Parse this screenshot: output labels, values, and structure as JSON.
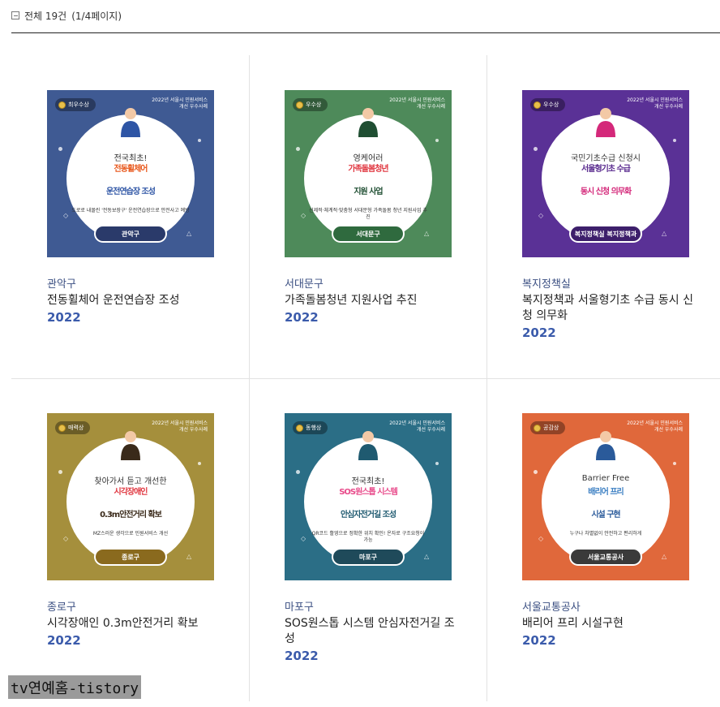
{
  "summary": {
    "total": "전체 19건",
    "page": "(1/4페이지)"
  },
  "cards": [
    {
      "dept": "관악구",
      "title": "전동휠체어 운전연습장 조성",
      "year": "2022",
      "bg": "#3f5a93",
      "accent": "#e8571b",
      "accent2": "#2e55a5",
      "pill_bg": "#2a3a6a",
      "award": "최우수상",
      "corner": "2022년 서울시 민원서비스 개선 우수사례",
      "pre": "전국최초!",
      "big1": "전동휠체어",
      "big2": "운전연습장 조성",
      "sub": "도로로 내몰린 '전동보장구' 운전연습장으로 안전사고 예방",
      "pill": "관악구"
    },
    {
      "dept": "서대문구",
      "title": "가족돌봄청년 지원사업 추진",
      "year": "2022",
      "bg": "#4e8a5a",
      "accent": "#e0363f",
      "accent2": "#1f4e32",
      "pill_bg": "#2f6a3e",
      "award": "우수상",
      "corner": "2022년 서울시 민원서비스 개선 우수사례",
      "pre": "영케어러",
      "big1": "가족돌봄청년",
      "big2": "지원 사업",
      "sub": "선제적·체계적·맞춤형 서대문형 가족돌봄 청년 지원사업 추진",
      "pill": "서대문구"
    },
    {
      "dept": "복지정책실",
      "title": "복지정책과 서울형기초 수급 동시 신청 의무화",
      "year": "2022",
      "bg": "#5a3196",
      "accent": "#5a2b8f",
      "accent2": "#d4287a",
      "pill_bg": "#3d1f6b",
      "award": "우수상",
      "corner": "2022년 서울시 민원서비스 개선 우수사례",
      "pre": "국민기초수급 신청시",
      "big1": "서울형기초 수급",
      "big2": "동시 신청 의무화",
      "sub": "",
      "pill": "복지정책실 복지정책과"
    },
    {
      "dept": "종로구",
      "title": "시각장애인 0.3m안전거리 확보",
      "year": "2022",
      "bg": "#a58f3c",
      "accent": "#e0363f",
      "accent2": "#3a2a1a",
      "pill_bg": "#8a6a1e",
      "award": "매력상",
      "corner": "2022년 서울시 민원서비스 개선 우수사례",
      "pre": "찾아가서 듣고 개선한",
      "big1": "시각장애인",
      "big2": "0.3m안전거리 확보",
      "sub": "MZ스러운 생각으로 민원서비스 개선",
      "pill": "종로구"
    },
    {
      "dept": "마포구",
      "title": "SOS원스톱 시스템 안심자전거길 조성",
      "year": "2022",
      "bg": "#2b6e86",
      "accent": "#e84a8a",
      "accent2": "#1f5a70",
      "pill_bg": "#1f4a5a",
      "award": "동행상",
      "corner": "2022년 서울시 민원서비스 개선 우수사례",
      "pre": "전국최초!",
      "big1": "SOS원스톱 시스템",
      "big2": "안심자전거길 조성",
      "sub": "QR코드 활영으로 정확한 위치 확인! 온자로 구조요청이 가능",
      "pill": "마포구"
    },
    {
      "dept": "서울교통공사",
      "title": "배리어 프리 시설구현",
      "year": "2022",
      "bg": "#e0683b",
      "accent": "#3a7ec2",
      "accent2": "#2a5a9a",
      "pill_bg": "#3a3a3a",
      "award": "공감상",
      "corner": "2022년 서울시 민원서비스 개선 우수사례",
      "pre": "Barrier Free",
      "big1": "배리어 프리",
      "big2": "시설 구현",
      "sub": "누구나 차별없이 안전하고 편리하게",
      "pill": "서울교통공사"
    }
  ],
  "watermark": "tv연예홈-tistory"
}
